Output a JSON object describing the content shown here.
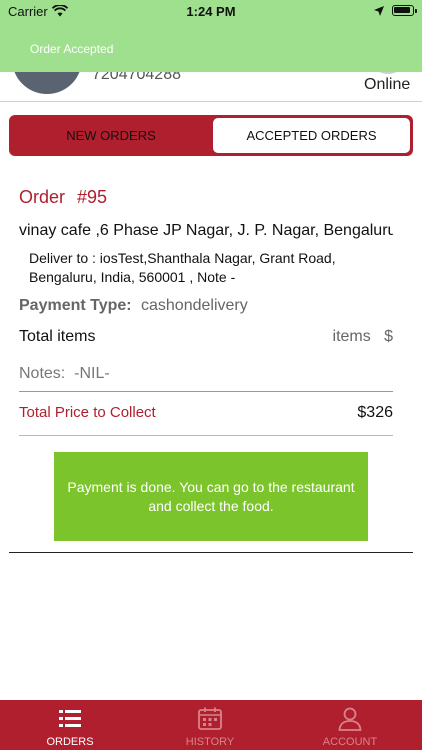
{
  "status_bar": {
    "carrier": "Carrier",
    "time": "1:24 PM"
  },
  "banner": {
    "text": "Order Accepted"
  },
  "profile": {
    "phone": "7204704288",
    "status": "Online"
  },
  "segments": {
    "new_orders": "NEW ORDERS",
    "accepted_orders": "ACCEPTED ORDERS",
    "selected": "accepted_orders"
  },
  "order": {
    "title": "Order",
    "number": "#95",
    "restaurant": "vinay cafe ,6 Phase JP Nagar, J. P. Nagar, Bengaluru",
    "deliver_to": "Deliver to : iosTest,Shanthala Nagar, Grant Road, Bengaluru, India, 560001 , Note -",
    "payment_type_label": "Payment Type:",
    "payment_type_value": "cashondelivery",
    "total_items_label": "Total items",
    "total_items_value": "items   $",
    "notes": "Notes:  -NIL-",
    "total_price_label": "Total Price to Collect",
    "total_price_value": "$326"
  },
  "payment_message": "Payment is done. You can go to the restaurant and collect the food.",
  "tabbar": {
    "orders": "ORDERS",
    "history": "HISTORY",
    "account": "ACCOUNT",
    "active": "orders"
  },
  "colors": {
    "brand_red": "#b01f2e",
    "banner_green": "#9fe08e",
    "payment_green": "#7cc42b"
  }
}
